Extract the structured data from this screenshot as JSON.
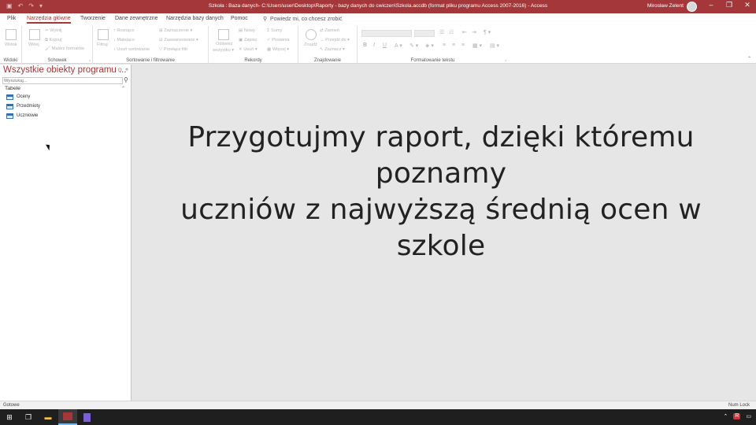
{
  "window": {
    "title": "Szkoła : Baza danych- C:\\Users\\user\\Desktop\\Raporty - bazy danych do cwiczen\\Szkola.accdb (format pliku programu Access 2007-2016)  -  Access",
    "user": "Mirosław Zelent",
    "accent": "#a4373a"
  },
  "tabs": [
    {
      "label": "Plik"
    },
    {
      "label": "Narzędzia główne"
    },
    {
      "label": "Tworzenie"
    },
    {
      "label": "Dane zewnętrzne"
    },
    {
      "label": "Narzędzia bazy danych"
    },
    {
      "label": "Pomoc"
    }
  ],
  "tellme": "Powiedz mi, co chcesz zrobić",
  "ribbon": {
    "widoki": {
      "label": "Widoki",
      "widok": "Widok"
    },
    "schowek": {
      "label": "Schowek",
      "wklej": "Wklej",
      "wytnij": "Wytnij",
      "kopiuj": "Kopiuj",
      "malarz": "Malarz formatów"
    },
    "sort": {
      "label": "Sortowanie i filtrowanie",
      "filtruj": "Filtruj",
      "rosnaco": "Rosnąco",
      "malejaco": "Malejąco",
      "usun": "Usuń sortowanie",
      "zaznaczenie": "Zaznaczenie",
      "zaawansowane": "Zaawansowane",
      "przelacz": "Przełącz filtr"
    },
    "rekordy": {
      "label": "Rekordy",
      "odswiez": "Odśwież",
      "wszystko": "wszystko",
      "nowy": "Nowy",
      "zapisz": "Zapisz",
      "usun": "Usuń",
      "sumy": "Sumy",
      "pisownia": "Pisownia",
      "wiecej": "Więcej"
    },
    "znajdowanie": {
      "label": "Znajdowanie",
      "znajdz": "Znajdź",
      "zamien": "Zamień",
      "przejdz": "Przejdź do",
      "zaznacz": "Zaznacz"
    },
    "format": {
      "label": "Formatowanie tekstu",
      "bold": "B",
      "italic": "I",
      "underline": "U"
    }
  },
  "navpane": {
    "header": "Wszystkie obiekty programu ...",
    "search_placeholder": "Wyszukaj...",
    "group": "Tabele",
    "items": [
      {
        "label": "Oceny"
      },
      {
        "label": "Przedmioty"
      },
      {
        "label": "Uczniowie"
      }
    ]
  },
  "main": {
    "line1": "Przygotujmy raport, dzięki któremu poznamy",
    "line2": "uczniów z najwyższą średnią ocen w szkole"
  },
  "status": {
    "left": "Gotowe",
    "right": "Num Lock"
  }
}
